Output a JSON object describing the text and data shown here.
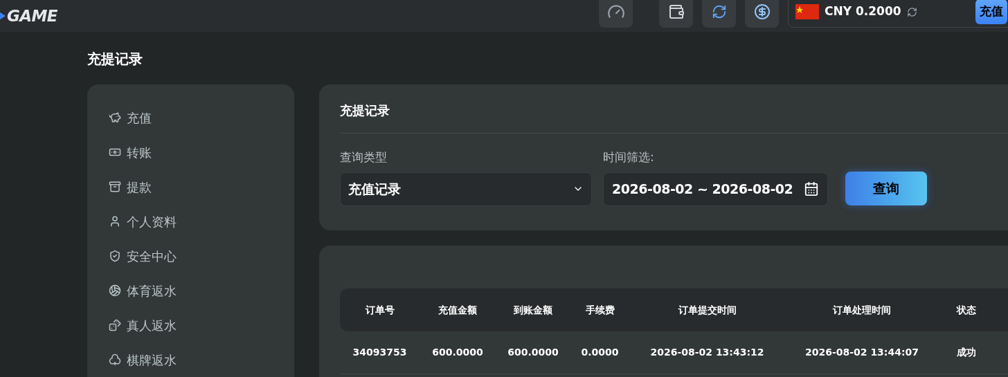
{
  "header": {
    "logo": "GAME",
    "balance": {
      "currency": "CNY 0.2000"
    },
    "deposit_button": "充值"
  },
  "page_title": "充提记录",
  "sidebar": {
    "items": [
      {
        "label": "充值"
      },
      {
        "label": "转账"
      },
      {
        "label": "提款"
      },
      {
        "label": "个人资料"
      },
      {
        "label": "安全中心"
      },
      {
        "label": "体育返水"
      },
      {
        "label": "真人返水"
      },
      {
        "label": "棋牌返水"
      }
    ]
  },
  "filter_panel": {
    "title": "充提记录",
    "query_type": {
      "label": "查询类型",
      "value": "充值记录"
    },
    "time_filter": {
      "label": "时间筛选:",
      "value": "2026-08-02 ~ 2026-08-02"
    },
    "search_button": "查询"
  },
  "table": {
    "columns": [
      "订单号",
      "充值金额",
      "到账金额",
      "手续费",
      "订单提交时间",
      "订单处理时间",
      "状态"
    ],
    "rows": [
      [
        "34093753",
        "600.0000",
        "600.0000",
        "0.0000",
        "2026-08-02 13:43:12",
        "2026-08-02 13:44:07",
        "成功"
      ]
    ]
  }
}
